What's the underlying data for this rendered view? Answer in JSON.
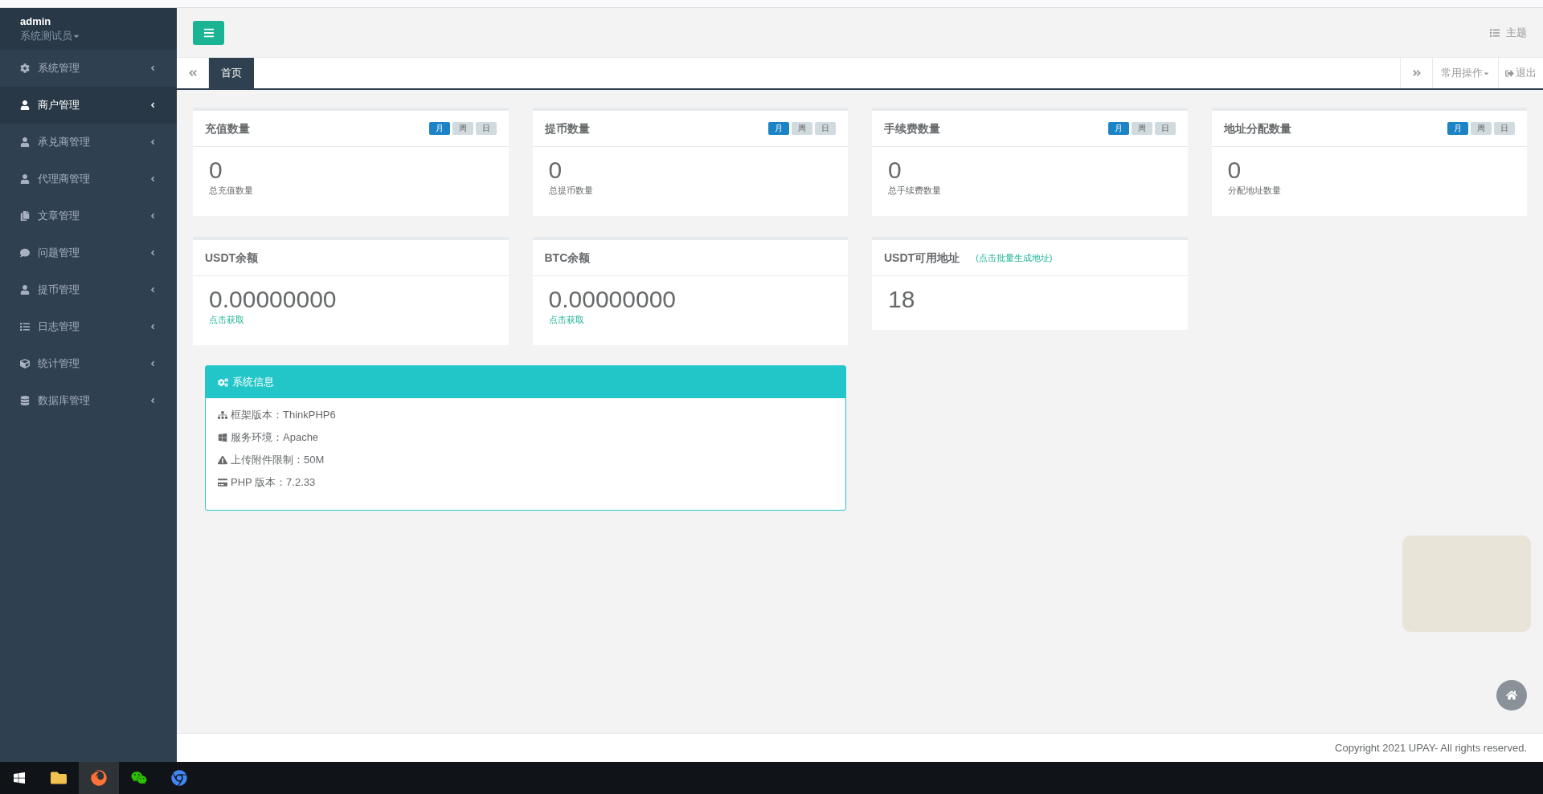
{
  "sidebar": {
    "user": {
      "name": "admin",
      "role": "系统测试员"
    },
    "items": [
      {
        "label": "系统管理",
        "kind": "gear",
        "selected": false
      },
      {
        "label": "商户管理",
        "kind": "user",
        "selected": true
      },
      {
        "label": "承兑商管理",
        "kind": "user",
        "selected": false
      },
      {
        "label": "代理商管理",
        "kind": "user",
        "selected": false
      },
      {
        "label": "文章管理",
        "kind": "copy",
        "selected": false
      },
      {
        "label": "问题管理",
        "kind": "comment",
        "selected": false
      },
      {
        "label": "提币管理",
        "kind": "user",
        "selected": false
      },
      {
        "label": "日志管理",
        "kind": "list",
        "selected": false
      },
      {
        "label": "统计管理",
        "kind": "cube",
        "selected": false
      },
      {
        "label": "数据库管理",
        "kind": "database",
        "selected": false
      }
    ]
  },
  "header": {
    "theme": "主题"
  },
  "tabs": {
    "items": [
      {
        "label": "首页",
        "selected": true
      }
    ],
    "common_ops": "常用操作",
    "logout": "退出"
  },
  "stat_cards": [
    {
      "title": "充值数量",
      "periods": [
        {
          "label": "月",
          "selected": true
        },
        {
          "label": "周",
          "selected": false
        },
        {
          "label": "日",
          "selected": false
        }
      ],
      "value": "0",
      "caption": "总充值数量"
    },
    {
      "title": "提币数量",
      "periods": [
        {
          "label": "月",
          "selected": true
        },
        {
          "label": "周",
          "selected": false
        },
        {
          "label": "日",
          "selected": false
        }
      ],
      "value": "0",
      "caption": "总提币数量"
    },
    {
      "title": "手续费数量",
      "periods": [
        {
          "label": "月",
          "selected": true
        },
        {
          "label": "周",
          "selected": false
        },
        {
          "label": "日",
          "selected": false
        }
      ],
      "value": "0",
      "caption": "总手续费数量"
    },
    {
      "title": "地址分配数量",
      "periods": [
        {
          "label": "月",
          "selected": true
        },
        {
          "label": "周",
          "selected": false
        },
        {
          "label": "日",
          "selected": false
        }
      ],
      "value": "0",
      "caption": "分配地址数量"
    }
  ],
  "balance_cards": [
    {
      "title": "USDT余额",
      "value": "0.00000000",
      "link": "点击获取"
    },
    {
      "title": "BTC余额",
      "value": "0.00000000",
      "link": "点击获取"
    },
    {
      "title": "USDT可用地址",
      "title_link": "(点击批量生成地址)",
      "value": "18"
    }
  ],
  "system_info": {
    "title": "系统信息",
    "rows": [
      {
        "kind": "sitemap",
        "text": "框架版本：ThinkPHP6"
      },
      {
        "kind": "windows",
        "text": "服务环境：Apache"
      },
      {
        "kind": "warning",
        "text": "上传附件限制：50M"
      },
      {
        "kind": "card",
        "text": "PHP 版本：7.2.33"
      }
    ]
  },
  "footer": "Copyright 2021 UPAY- All rights reserved."
}
